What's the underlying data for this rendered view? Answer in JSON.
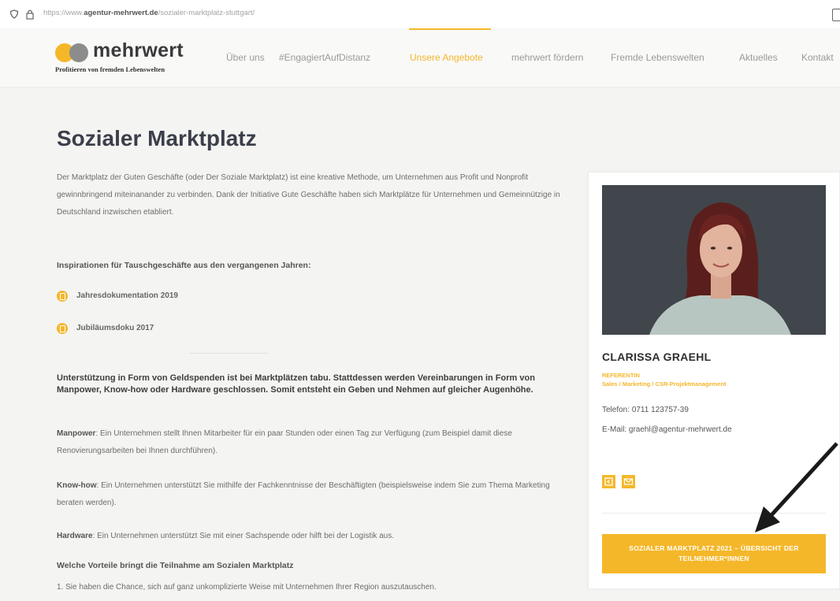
{
  "browser": {
    "url_prefix": "https://www.",
    "url_domain": "agentur-mehrwert.de",
    "url_path": "/sozialer-marktplatz-stuttgart/"
  },
  "header": {
    "logo_word": "mehrwert",
    "logo_tagline": "Profitieren von fremden Lebenswelten",
    "nav": [
      {
        "label": "Über uns"
      },
      {
        "label": "#EngagiertAufDistanz"
      },
      {
        "label": "Unsere Angebote"
      },
      {
        "label": "mehrwert fördern"
      },
      {
        "label": "Fremde Lebenswelten"
      },
      {
        "label": "Aktuelles"
      },
      {
        "label": "Kontakt"
      }
    ]
  },
  "main": {
    "title": "Sozialer Marktplatz",
    "intro": "Der Marktplatz der Guten Geschäfte (oder Der Soziale Marktplatz) ist eine kreative Methode, um Unternehmen aus Profit und Nonprofit gewinnbringend miteinanander zu verbinden. Dank der Initiative Gute Geschäfte haben sich Marktplätze für Unternehmen und Gemeinnützige in Deutschland inzwischen etabliert.",
    "inspiration_heading": "Inspirationen für Tauschgeschäfte aus den vergangenen Jahren:",
    "docs": [
      {
        "label": "Jahresdokumentation 2019"
      },
      {
        "label": "Jubiläumsdoku 2017"
      }
    ],
    "bold_paragraph": "Unterstützung in Form von Geldspenden ist bei Marktplätzen tabu. Stattdessen werden Vereinbarungen in Form von Manpower, Know-how oder Hardware geschlossen. Somit entsteht ein Geben und Nehmen auf gleicher Augenhöhe.",
    "manpower_term": "Manpower",
    "manpower_text": ": Ein Unternehmen stellt Ihnen Mitarbeiter für ein paar Stunden oder einen Tag zur Verfügung (zum Beispiel damit diese Renovierungsarbeiten bei Ihnen durchführen).",
    "knowhow_term": "Know-how",
    "knowhow_text": ": Ein Unternehmen unterstützt Sie mithilfe der Fachkenntnisse der Beschäftigten (beispielsweise indem Sie zum Thema Marketing beraten werden).",
    "hardware_term": "Hardware",
    "hardware_text": ": Ein Unternehmen unterstützt Sie mit einer Sachspende oder hilft bei der Logistik aus.",
    "benefits_heading": "Welche Vorteile bringt die Teilnahme am Sozialen Marktplatz",
    "benefit_1": "1. Sie haben die Chance, sich auf ganz unkomplizierte Weise mit Unternehmen Ihrer Region auszutauschen."
  },
  "sidebar": {
    "name": "CLARISSA GRAEHL",
    "role": "REFERENTIN",
    "department": "Sales / Marketing / CSR-Projektmanagement",
    "phone_label": "Telefon:",
    "phone": "0711 123757-39",
    "email_label": "E-Mail:",
    "email": "graehl@agentur-mehrwert.de",
    "icons": [
      "vcard-icon",
      "mail-icon"
    ],
    "cta_label": "SOZIALER MARKTPLATZ 2021 – ÜBERSICHT DER TEILNEHMER*INNEN"
  },
  "colors": {
    "accent": "#f5b72a",
    "heading": "#3b3f4a",
    "annotation_arrow": "#1a1a1a"
  }
}
